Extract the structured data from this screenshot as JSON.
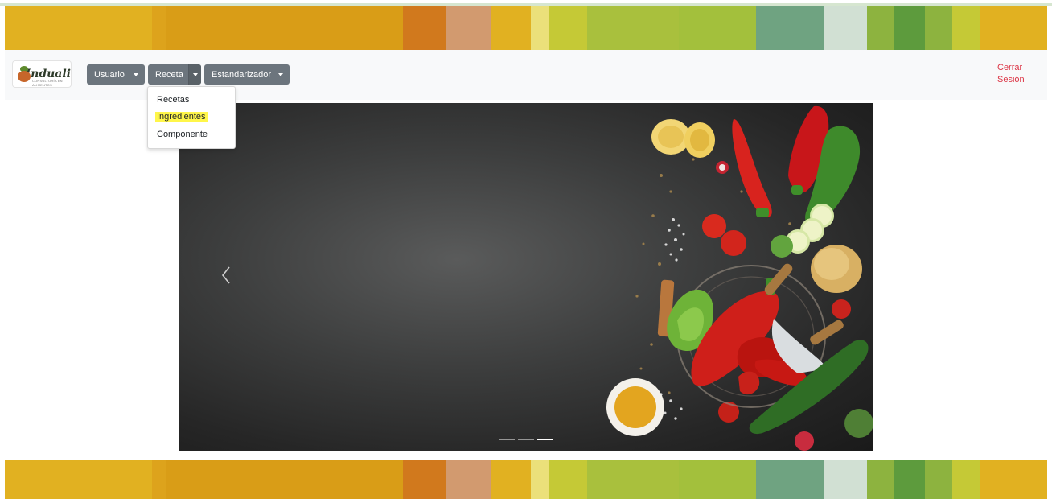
{
  "brand": {
    "name": "Induali",
    "tagline": "CONSULTORÍA EN ALIMENTOS"
  },
  "nav": {
    "usuario": "Usuario",
    "receta": "Receta",
    "estandarizador": "Estandarizador",
    "logout_line1": "Cerrar",
    "logout_line2": "Sesión"
  },
  "receta_dropdown": {
    "items": [
      "Recetas",
      "Ingredientes",
      "Componente"
    ],
    "highlighted": "Ingredientes"
  },
  "carousel": {
    "slide_count": 3,
    "active_slide": 3,
    "image_description": "Fresh vegetables on dark slate background"
  },
  "colors": {
    "navbar_bg": "#f8f9fa",
    "button_bg": "#6c757d",
    "logout_text": "#dc3545",
    "highlight": "#fff64a",
    "stripes": [
      "#e1b121",
      "#dda31c",
      "#d99d17",
      "#d1791d",
      "#d29a6f",
      "#e1b121",
      "#ebe07a",
      "#c5c936",
      "#a9c03d",
      "#a3c03c",
      "#6fa381",
      "#d1e0d3",
      "#8db33f",
      "#5d9b3d",
      "#8db33f",
      "#c5c936",
      "#e1b121"
    ]
  }
}
